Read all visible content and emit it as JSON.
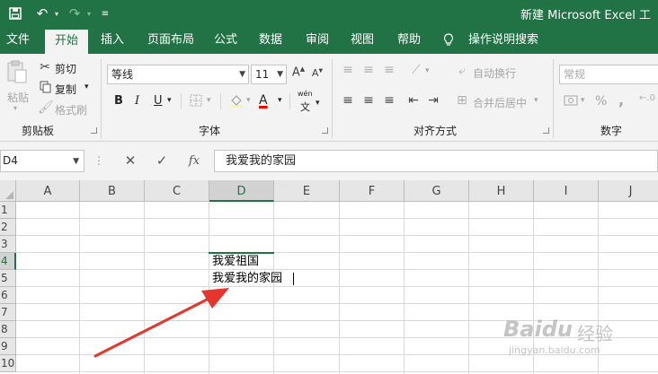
{
  "titlebar": {
    "title": "新建 Microsoft Excel 工"
  },
  "tabs": [
    "文件",
    "开始",
    "插入",
    "页面布局",
    "公式",
    "数据",
    "审阅",
    "视图",
    "帮助"
  ],
  "tell_me": "操作说明搜索",
  "ribbon": {
    "clipboard": {
      "paste": "粘贴",
      "cut": "剪切",
      "copy": "复制",
      "format_painter": "格式刷",
      "label": "剪贴板"
    },
    "font": {
      "font_name": "等线",
      "font_size": "11",
      "bold": "B",
      "italic": "I",
      "underline": "U",
      "font_color_glyph": "A",
      "wen": "wén",
      "wen_char": "文",
      "label": "字体"
    },
    "alignment": {
      "wrap_text": "自动换行",
      "merge_center": "合并后居中",
      "label": "对齐方式"
    },
    "number": {
      "format": "常规",
      "percent": "%",
      "comma": ",",
      "label": "数字"
    }
  },
  "formula_bar": {
    "name_box": "D4",
    "cancel": "✕",
    "confirm": "✓",
    "fx": "fx",
    "content": "我爱我的家园"
  },
  "grid": {
    "columns": [
      "A",
      "B",
      "C",
      "D",
      "E",
      "F",
      "G",
      "H",
      "I",
      "J"
    ],
    "rows": [
      "1",
      "2",
      "3",
      "4",
      "5",
      "6",
      "7",
      "8",
      "9",
      "10"
    ],
    "selected_column": "D",
    "selected_row": "4",
    "cells": {
      "D4": "我爱祖国",
      "D5": "我爱我的家园"
    }
  },
  "watermark": {
    "brand": "Baidu",
    "brand_cn": "经验",
    "url": "jingyan.baidu.com"
  },
  "colors": {
    "excel_green": "#217346",
    "arrow_red": "#e8352b",
    "font_color_bar": "#ff0000"
  }
}
